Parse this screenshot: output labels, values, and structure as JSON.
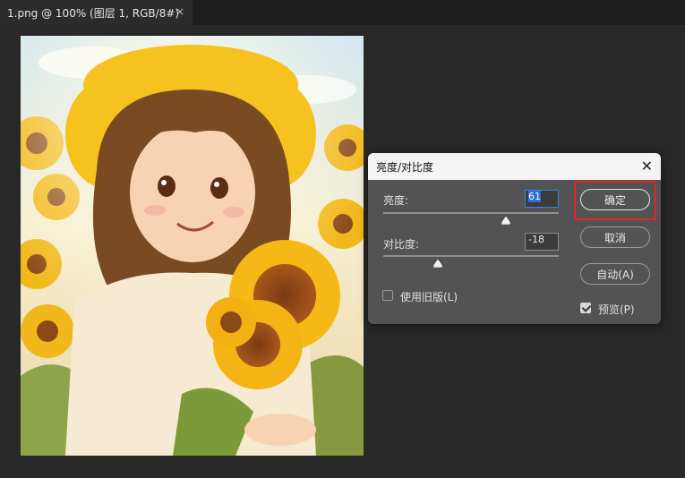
{
  "document_tab": {
    "title": "1.png @ 100% (图层 1, RGB/8#)",
    "close_glyph": "×"
  },
  "dialog": {
    "title": "亮度/对比度",
    "close_glyph": "✕",
    "brightness": {
      "label": "亮度:",
      "value": "61",
      "slider_fraction": 0.7
    },
    "contrast": {
      "label": "对比度:",
      "value": "-18",
      "slider_fraction": 0.31
    },
    "legacy": {
      "label": "使用旧版(L)",
      "checked": false
    },
    "preview": {
      "label": "预览(P)",
      "checked": true
    },
    "buttons": {
      "ok": "确定",
      "cancel": "取消",
      "auto": "自动(A)"
    }
  },
  "colors": {
    "highlight": "#e0262b",
    "focus_blue": "#2f86e8"
  }
}
